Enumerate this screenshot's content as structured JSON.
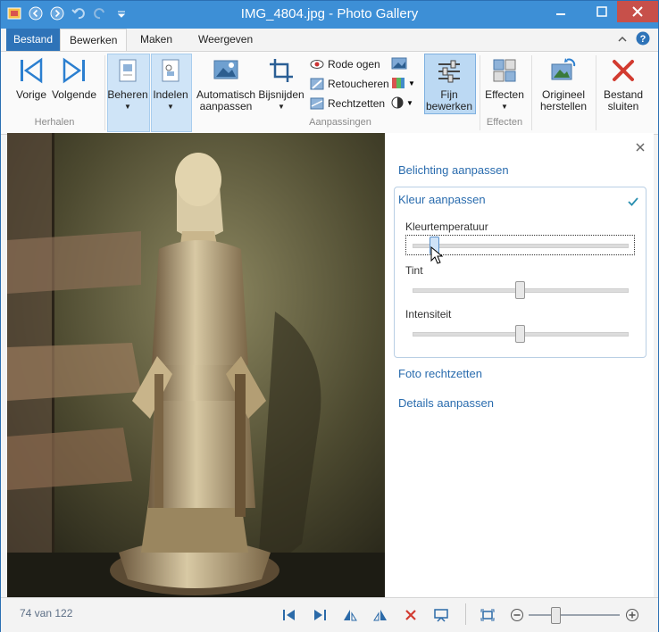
{
  "window": {
    "title": "IMG_4804.jpg - Photo Gallery"
  },
  "menu": {
    "file": "Bestand",
    "tabs": [
      "Bewerken",
      "Maken",
      "Weergeven"
    ]
  },
  "ribbon": {
    "vorige": "Vorige",
    "volgende": "Volgende",
    "herhalen": "Herhalen",
    "beheren": "Beheren",
    "indelen": "Indelen",
    "auto_1": "Automatisch",
    "auto_2": "aanpassen",
    "bijsnijden": "Bijsnijden",
    "rode_ogen": "Rode ogen",
    "retoucheren": "Retoucheren",
    "rechtzetten": "Rechtzetten",
    "fijn_1": "Fijn",
    "fijn_2": "bewerken",
    "aanpassingen": "Aanpassingen",
    "effecten": "Effecten",
    "effecten_group": "Effecten",
    "origineel_1": "Origineel",
    "origineel_2": "herstellen",
    "sluiten_1": "Bestand",
    "sluiten_2": "sluiten"
  },
  "panel": {
    "belichting": "Belichting aanpassen",
    "kleur": "Kleur aanpassen",
    "kleurtemperatuur": "Kleurtemperatuur",
    "tint": "Tint",
    "intensiteit": "Intensiteit",
    "foto_rechtzetten": "Foto rechtzetten",
    "details": "Details aanpassen",
    "sliders": {
      "kleurtemperatuur": 0.1,
      "tint": 0.5,
      "intensiteit": 0.5
    }
  },
  "status": {
    "counter": "74 van 122",
    "zoom": 0.29
  },
  "colors": {
    "accent": "#3d8fd6",
    "link": "#2a6cae",
    "close": "#c7504a"
  }
}
